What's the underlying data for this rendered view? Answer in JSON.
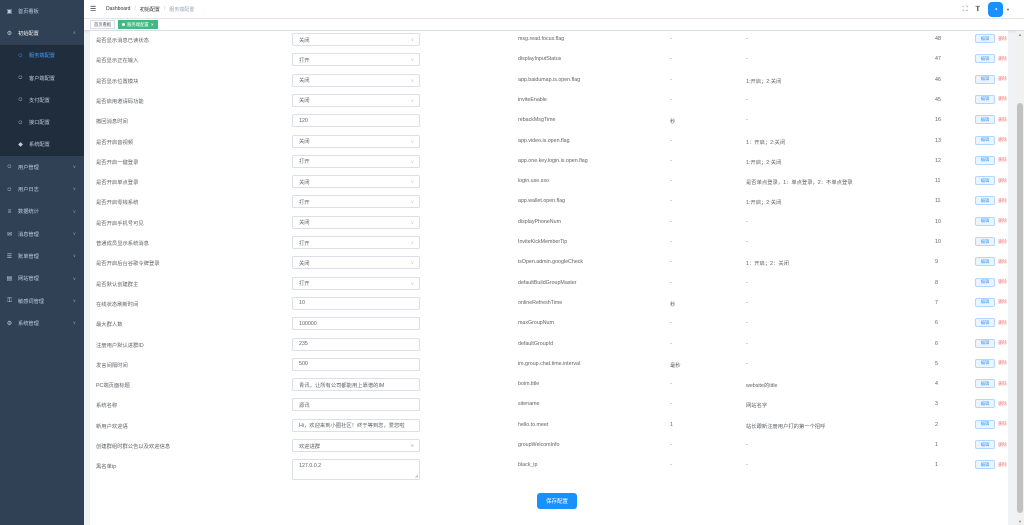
{
  "sidebar": {
    "items": [
      {
        "label": "首页看板",
        "icon": "dashboard-icon",
        "level": 0
      },
      {
        "label": "初始配置",
        "icon": "settings-icon",
        "level": 0,
        "open": true
      },
      {
        "label": "服务端配置",
        "icon": "user-icon",
        "level": 1,
        "active": true
      },
      {
        "label": "客户端配置",
        "icon": "user-icon",
        "level": 1
      },
      {
        "label": "支付配置",
        "icon": "user-icon",
        "level": 1
      },
      {
        "label": "接口配置",
        "icon": "user-icon",
        "level": 1
      },
      {
        "label": "系统配置",
        "icon": "gem-icon",
        "level": 1
      },
      {
        "label": "用户管理",
        "icon": "user-icon",
        "level": 0
      },
      {
        "label": "用户日志",
        "icon": "user-icon",
        "level": 0
      },
      {
        "label": "数据统计",
        "icon": "chart-icon",
        "level": 0
      },
      {
        "label": "消息管理",
        "icon": "message-icon",
        "level": 0
      },
      {
        "label": "账单管理",
        "icon": "bill-icon",
        "level": 0
      },
      {
        "label": "网站管理",
        "icon": "website-icon",
        "level": 0
      },
      {
        "label": "敏感词管理",
        "icon": "key-icon",
        "level": 0
      },
      {
        "label": "系统管理",
        "icon": "gear-icon",
        "level": 0
      }
    ]
  },
  "navbar": {
    "breadcrumb": [
      "Dashboard",
      "初始配置",
      "服务端配置"
    ]
  },
  "tags": [
    {
      "label": "首页看板",
      "active": false
    },
    {
      "label": "服务端配置",
      "active": true
    }
  ],
  "rows": [
    {
      "label": "是否显示消息已读状态",
      "value": "关闭",
      "kind": "select",
      "key": "msg.read.focus.flag",
      "unit": "-",
      "desc": "-",
      "sort": "48"
    },
    {
      "label": "是否显示正在输入",
      "value": "打开",
      "kind": "select",
      "key": "displayInputStatus",
      "unit": "-",
      "desc": "-",
      "sort": "47"
    },
    {
      "label": "是否显示位置模块",
      "value": "关闭",
      "kind": "select",
      "key": "app.baidumap.is.open.flag",
      "unit": "-",
      "desc": "1:开启；2:关闭",
      "sort": "46"
    },
    {
      "label": "是否启用邀请码功能",
      "value": "关闭",
      "kind": "select",
      "key": "inviteEnable",
      "unit": "-",
      "desc": "-",
      "sort": "45"
    },
    {
      "label": "撤回消息时间",
      "value": "120",
      "kind": "input",
      "key": "rebackMsgTime",
      "unit": "秒",
      "desc": "-",
      "sort": "16"
    },
    {
      "label": "是否开启音视频",
      "value": "关闭",
      "kind": "select",
      "key": "app.video.is.open.flag",
      "unit": "-",
      "desc": "1：开启；2:关闭",
      "sort": "13"
    },
    {
      "label": "是否开启一键登录",
      "value": "打开",
      "kind": "select",
      "key": "app.one.key.login.is.open.flag",
      "unit": "-",
      "desc": "1:开启；2:关闭",
      "sort": "12"
    },
    {
      "label": "是否开启单点登录",
      "value": "关闭",
      "kind": "select",
      "key": "login.use.sso",
      "unit": "-",
      "desc": "是否单点登录，1：单点登录，2：不单点登录",
      "sort": "11"
    },
    {
      "label": "是否开启零钱系统",
      "value": "打开",
      "kind": "select",
      "key": "app.wallet.open.flag",
      "unit": "-",
      "desc": "1:开启；2:关闭",
      "sort": "11"
    },
    {
      "label": "是否开启手机号可见",
      "value": "关闭",
      "kind": "select",
      "key": "displayPhoneNum",
      "unit": "-",
      "desc": "-",
      "sort": "10"
    },
    {
      "label": "普通成员显示系统消息",
      "value": "打开",
      "kind": "select",
      "key": "InviteKickMemberTip",
      "unit": "-",
      "desc": "-",
      "sort": "10"
    },
    {
      "label": "是否开启后台谷歌令牌登录",
      "value": "关闭",
      "kind": "select",
      "key": "isOpen.admin.googleCheck",
      "unit": "-",
      "desc": "1：开启；2：关闭",
      "sort": "9"
    },
    {
      "label": "是否默认创建群主",
      "value": "打开",
      "kind": "select",
      "key": "defaultBuildGroupMaster",
      "unit": "-",
      "desc": "-",
      "sort": "8"
    },
    {
      "label": "在线状态刷新时间",
      "value": "10",
      "kind": "input",
      "key": "onlineRefreshTime",
      "unit": "秒",
      "desc": "-",
      "sort": "7"
    },
    {
      "label": "最大群人数",
      "value": "100000",
      "kind": "input",
      "key": "maxGroupNum",
      "unit": "-",
      "desc": "-",
      "sort": "6"
    },
    {
      "label": "注册用户默认进群ID",
      "value": "235",
      "kind": "input",
      "key": "defaultGroupId",
      "unit": "-",
      "desc": "-",
      "sort": "6"
    },
    {
      "label": "发言间隔时间",
      "value": "500",
      "kind": "input",
      "key": "im.group.chat.time.interval",
      "unit": "毫秒",
      "desc": "-",
      "sort": "5"
    },
    {
      "label": "PC端页面标题",
      "value": "青讯，让所有公司都能用上靠谱的IM",
      "kind": "input",
      "key": "boim.title",
      "unit": "-",
      "desc": "website的title",
      "sort": "4"
    },
    {
      "label": "系统名称",
      "value": "源讯",
      "kind": "input",
      "key": "sitename",
      "unit": "-",
      "desc": "网站名字",
      "sort": "3"
    },
    {
      "label": "新用户欢迎语",
      "value": "Hi，欢迎来到小圈社区！终于等到您，爱您啦",
      "kind": "input",
      "key": "hello.to.meet",
      "unit": "1",
      "desc": "站长跟新注册用户打的第一个招呼",
      "sort": "2"
    },
    {
      "label": "创建群组时群公告以及欢迎信息",
      "value": "欢迎进群",
      "kind": "clearable",
      "key": "groupWelcomInfo",
      "unit": "-",
      "desc": "-",
      "sort": "1"
    },
    {
      "label": "黑名单ip",
      "value": "127.0.0.2",
      "kind": "textarea",
      "key": "black_ip",
      "unit": "-",
      "desc": "-",
      "sort": "1"
    }
  ],
  "actions": {
    "edit_label": "编辑",
    "delete_label": "删除",
    "save_label": "保存配置"
  },
  "colors": {
    "sidebar_bg": "#304156",
    "accent": "#1890ff",
    "tag_active": "#42b983",
    "delete": "#f56c6c"
  }
}
